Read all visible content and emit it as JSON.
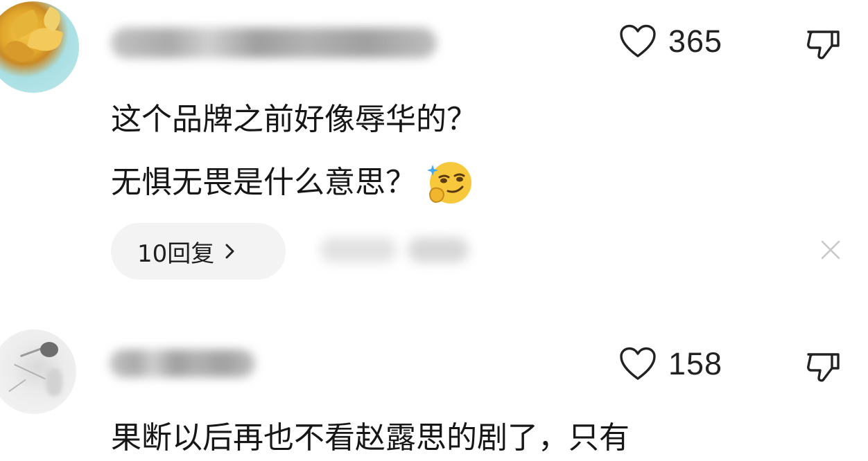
{
  "comments": [
    {
      "likes": "365",
      "text_lines": [
        "这个品牌之前好像辱华的？",
        "无惧无畏是什么意思？"
      ],
      "emoji": "smirking-thinking-emoji",
      "replies_label": "10回复"
    },
    {
      "likes": "158",
      "text_lines": [
        "果断以后再也不看赵露思的剧了，只有"
      ]
    }
  ],
  "icons": {
    "like": "heart-outline-icon",
    "dislike": "thumbs-down-outline-icon",
    "replies_chevron": "chevron-right-icon",
    "dismiss": "close-icon"
  },
  "colors": {
    "text": "#161616",
    "pill_bg": "#f3f3f3",
    "icon_stroke": "#222222",
    "close_icon": "#c8c8c8",
    "emoji_face": "#f7c83c"
  }
}
